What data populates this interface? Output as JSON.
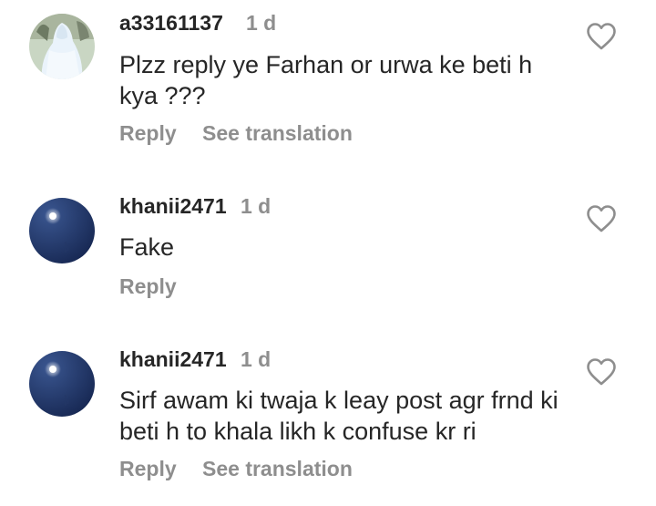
{
  "comments": [
    {
      "username": "a33161137",
      "time": "1 d",
      "text": "Plzz reply ye Farhan or urwa ke beti h kya ???",
      "reply_label": "Reply",
      "translate_label": "See translation",
      "avatar": "bride-photo-avatar"
    },
    {
      "username": "khanii2471",
      "time": "1 d",
      "text": "Fake",
      "reply_label": "Reply",
      "avatar": "moon-night-avatar"
    },
    {
      "username": "khanii2471",
      "time": "1 d",
      "text": "Sirf awam ki twaja k leay post agr frnd ki beti h to khala likh k confuse kr ri",
      "reply_label": "Reply",
      "translate_label": "See translation",
      "avatar": "moon-night-avatar"
    }
  ],
  "icons": {
    "like": "heart-outline-icon"
  },
  "colors": {
    "primary_text": "#262626",
    "secondary_text": "#8e8e8e",
    "background": "#ffffff"
  }
}
